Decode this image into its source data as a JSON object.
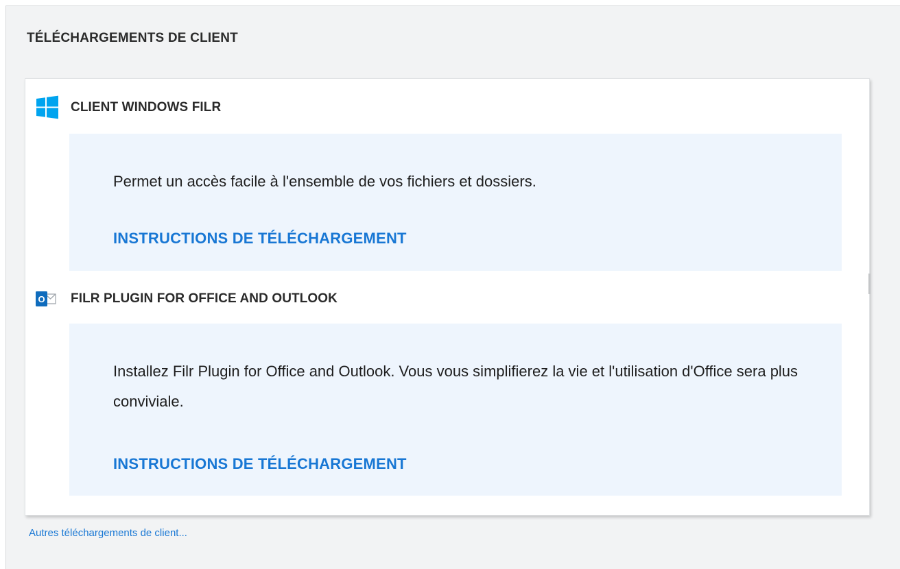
{
  "panel": {
    "title": "TÉLÉCHARGEMENTS DE CLIENT"
  },
  "sections": [
    {
      "icon": "windows-logo-icon",
      "title": "CLIENT WINDOWS FILR",
      "description": "Permet un accès facile à l'ensemble de vos fichiers et dossiers.",
      "link_label": "INSTRUCTIONS DE TÉLÉCHARGEMENT"
    },
    {
      "icon": "outlook-logo-icon",
      "icon_letter": "O",
      "title": "FILR PLUGIN FOR OFFICE AND OUTLOOK",
      "description": "Installez Filr Plugin for Office and Outlook. Vous vous simplifierez la vie et l'utilisation d'Office sera plus conviviale.",
      "link_label": "INSTRUCTIONS DE TÉLÉCHARGEMENT"
    }
  ],
  "footer": {
    "more_link": "Autres téléchargements de client..."
  },
  "colors": {
    "panel_bg": "#f2f3f4",
    "info_bg": "#eef5fd",
    "link": "#1877d4",
    "windows_blue": "#00a4ef",
    "outlook_blue": "#0f6cbd"
  }
}
